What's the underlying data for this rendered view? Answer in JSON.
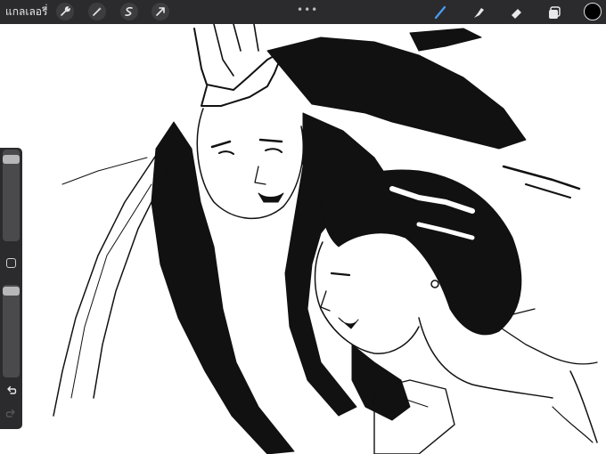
{
  "toolbar": {
    "gallery_label": "แกลเลอรี่",
    "left_tools": [
      "wrench-icon",
      "magic-wand-icon",
      "selection-icon",
      "transform-arrow-icon"
    ],
    "more": "•••",
    "right_tools": [
      "brush-icon",
      "smudge-icon",
      "eraser-icon",
      "layers-icon"
    ],
    "active_tool": "brush-icon",
    "active_color": "#4a9df8",
    "current_color": "#000000"
  },
  "sidebar": {
    "brush_size_level": 0.95,
    "opacity_level": 1.0,
    "undo_icon": "undo-arrow-icon",
    "redo_icon": "redo-arrow-icon"
  }
}
